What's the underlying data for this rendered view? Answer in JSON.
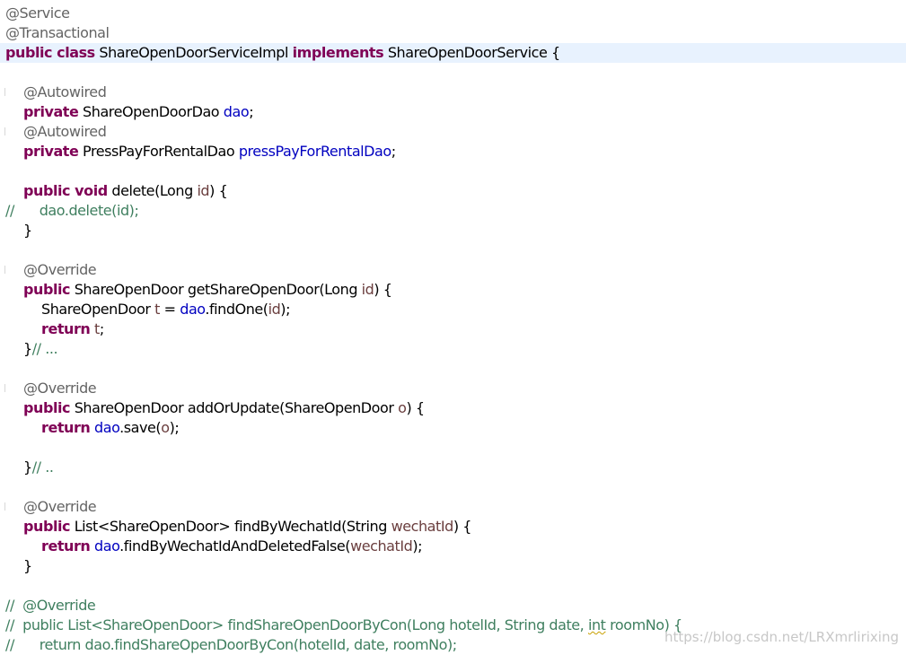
{
  "editor": {
    "current_line_index": 2,
    "lines": [
      {
        "indent": 0,
        "tokens": [
          {
            "t": "@Service",
            "c": "ann"
          }
        ]
      },
      {
        "indent": 0,
        "tokens": [
          {
            "t": "@Transactional",
            "c": "ann"
          }
        ]
      },
      {
        "indent": 0,
        "tokens": [
          {
            "t": "public class",
            "c": "kw"
          },
          {
            "t": " ShareOpenDoorServiceImpl ",
            "c": "typ"
          },
          {
            "t": "implements",
            "c": "kw"
          },
          {
            "t": " ShareOpenDoorService {",
            "c": "typ"
          }
        ]
      },
      {
        "indent": 0,
        "tokens": []
      },
      {
        "indent": 1,
        "tokens": [
          {
            "t": "@Autowired",
            "c": "ann"
          }
        ]
      },
      {
        "indent": 1,
        "tokens": [
          {
            "t": "private",
            "c": "kw"
          },
          {
            "t": " ShareOpenDoorDao ",
            "c": "typ"
          },
          {
            "t": "dao",
            "c": "fld"
          },
          {
            "t": ";",
            "c": "pun"
          }
        ]
      },
      {
        "indent": 1,
        "tokens": [
          {
            "t": "@Autowired",
            "c": "ann"
          }
        ]
      },
      {
        "indent": 1,
        "tokens": [
          {
            "t": "private",
            "c": "kw"
          },
          {
            "t": " PressPayForRentalDao ",
            "c": "typ"
          },
          {
            "t": "pressPayForRentalDao",
            "c": "fld"
          },
          {
            "t": ";",
            "c": "pun"
          }
        ]
      },
      {
        "indent": 0,
        "tokens": []
      },
      {
        "indent": 1,
        "tokens": [
          {
            "t": "public void",
            "c": "kw"
          },
          {
            "t": " delete(Long ",
            "c": "mth"
          },
          {
            "t": "id",
            "c": "var"
          },
          {
            "t": ") {",
            "c": "pun"
          }
        ]
      },
      {
        "indent": 0,
        "tokens": [
          {
            "t": "//      dao.delete(id);",
            "c": "cmt"
          }
        ]
      },
      {
        "indent": 1,
        "tokens": [
          {
            "t": "}",
            "c": "pun"
          }
        ]
      },
      {
        "indent": 0,
        "tokens": []
      },
      {
        "indent": 1,
        "tokens": [
          {
            "t": "@Override",
            "c": "ann"
          }
        ]
      },
      {
        "indent": 1,
        "tokens": [
          {
            "t": "public",
            "c": "kw"
          },
          {
            "t": " ShareOpenDoor getShareOpenDoor(Long ",
            "c": "typ"
          },
          {
            "t": "id",
            "c": "var"
          },
          {
            "t": ") {",
            "c": "pun"
          }
        ]
      },
      {
        "indent": 2,
        "tokens": [
          {
            "t": "ShareOpenDoor ",
            "c": "typ"
          },
          {
            "t": "t",
            "c": "var"
          },
          {
            "t": " = ",
            "c": "pun"
          },
          {
            "t": "dao",
            "c": "fld"
          },
          {
            "t": ".findOne(",
            "c": "mth"
          },
          {
            "t": "id",
            "c": "var"
          },
          {
            "t": ");",
            "c": "pun"
          }
        ]
      },
      {
        "indent": 2,
        "tokens": [
          {
            "t": "return",
            "c": "kw"
          },
          {
            "t": " ",
            "c": "pun"
          },
          {
            "t": "t",
            "c": "var"
          },
          {
            "t": ";",
            "c": "pun"
          }
        ]
      },
      {
        "indent": 1,
        "tokens": [
          {
            "t": "}",
            "c": "pun"
          },
          {
            "t": "// ...",
            "c": "cmt"
          }
        ]
      },
      {
        "indent": 0,
        "tokens": []
      },
      {
        "indent": 1,
        "tokens": [
          {
            "t": "@Override",
            "c": "ann"
          }
        ]
      },
      {
        "indent": 1,
        "tokens": [
          {
            "t": "public",
            "c": "kw"
          },
          {
            "t": " ShareOpenDoor addOrUpdate(ShareOpenDoor ",
            "c": "typ"
          },
          {
            "t": "o",
            "c": "var"
          },
          {
            "t": ") {",
            "c": "pun"
          }
        ]
      },
      {
        "indent": 2,
        "tokens": [
          {
            "t": "return",
            "c": "kw"
          },
          {
            "t": " ",
            "c": "pun"
          },
          {
            "t": "dao",
            "c": "fld"
          },
          {
            "t": ".save(",
            "c": "mth"
          },
          {
            "t": "o",
            "c": "var"
          },
          {
            "t": ");",
            "c": "pun"
          }
        ]
      },
      {
        "indent": 0,
        "tokens": []
      },
      {
        "indent": 1,
        "tokens": [
          {
            "t": "}",
            "c": "pun"
          },
          {
            "t": "// ..",
            "c": "cmt"
          }
        ]
      },
      {
        "indent": 0,
        "tokens": []
      },
      {
        "indent": 1,
        "tokens": [
          {
            "t": "@Override",
            "c": "ann"
          }
        ]
      },
      {
        "indent": 1,
        "tokens": [
          {
            "t": "public",
            "c": "kw"
          },
          {
            "t": " List<ShareOpenDoor> findByWechatId(String ",
            "c": "typ"
          },
          {
            "t": "wechatId",
            "c": "var"
          },
          {
            "t": ") {",
            "c": "pun"
          }
        ]
      },
      {
        "indent": 2,
        "tokens": [
          {
            "t": "return",
            "c": "kw"
          },
          {
            "t": " ",
            "c": "pun"
          },
          {
            "t": "dao",
            "c": "fld"
          },
          {
            "t": ".findByWechatIdAndDeletedFalse(",
            "c": "mth"
          },
          {
            "t": "wechatId",
            "c": "var"
          },
          {
            "t": ");",
            "c": "pun"
          }
        ]
      },
      {
        "indent": 1,
        "tokens": [
          {
            "t": "}",
            "c": "pun"
          }
        ]
      },
      {
        "indent": 0,
        "tokens": []
      },
      {
        "indent": 0,
        "tokens": [
          {
            "t": "//  @Override",
            "c": "cmt"
          }
        ]
      },
      {
        "indent": 0,
        "tokens": [
          {
            "t": "//  public List<ShareOpenDoor> findShareOpenDoorByCon(Long hotelId, String date, ",
            "c": "cmt"
          },
          {
            "t": "int",
            "c": "cmt",
            "squig": true
          },
          {
            "t": " roomNo) {",
            "c": "cmt"
          }
        ]
      },
      {
        "indent": 0,
        "tokens": [
          {
            "t": "//      return dao.findShareOpenDoorByCon(hotelId, date, roomNo);",
            "c": "cmt"
          }
        ]
      }
    ]
  },
  "watermark": "https://blog.csdn.net/LRXmrlirixing"
}
